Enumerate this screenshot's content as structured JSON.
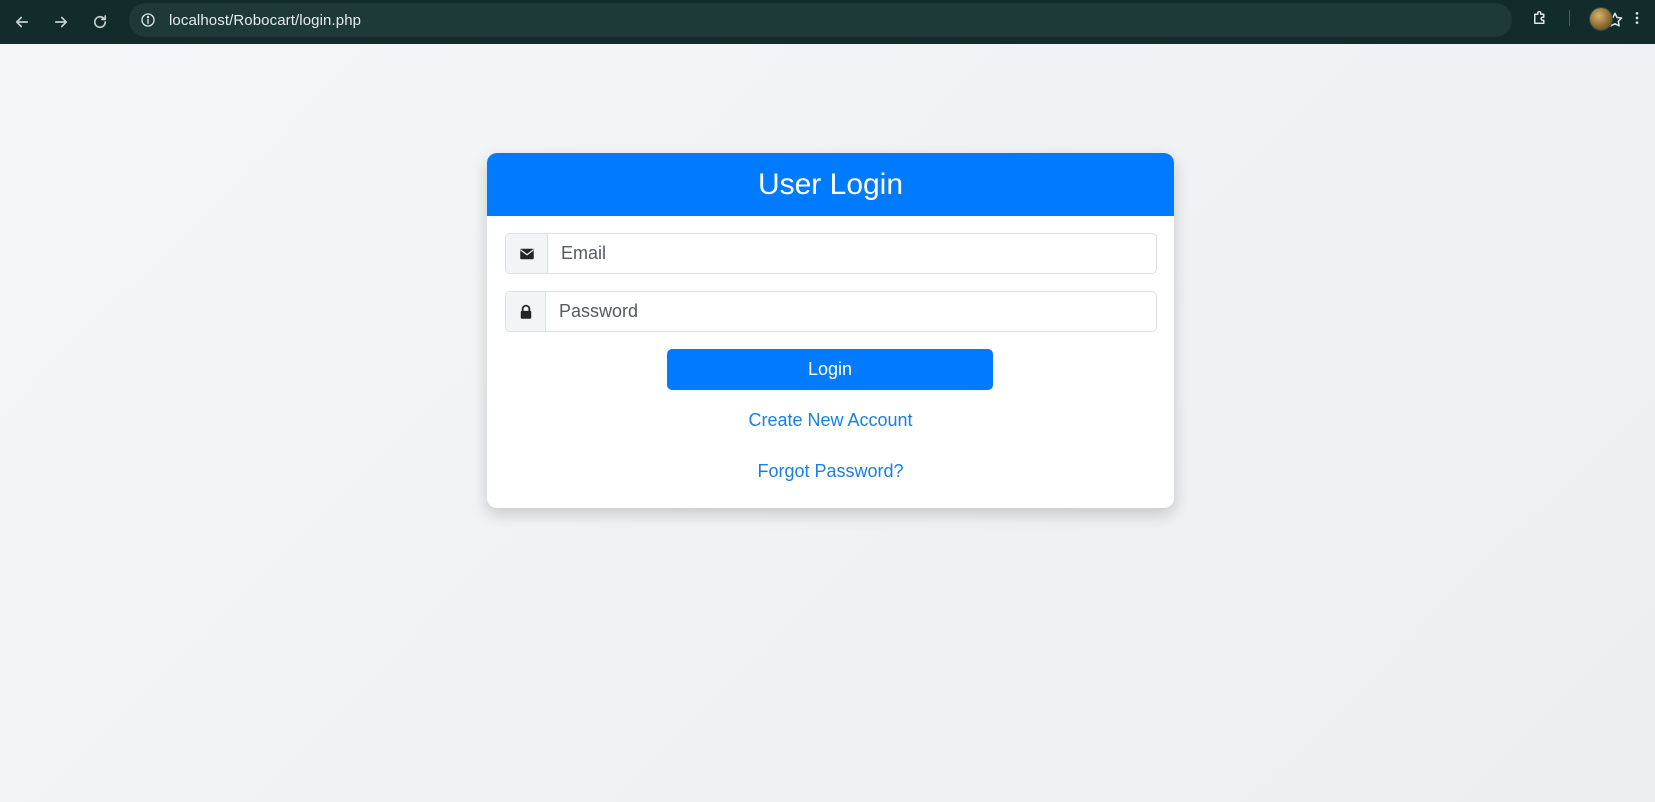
{
  "browser": {
    "url": "localhost/Robocart/login.php",
    "icons": {
      "back": "arrow-left-icon",
      "forward": "arrow-right-icon",
      "reload": "reload-icon",
      "site_info": "info-icon",
      "bookmark": "star-icon",
      "extensions": "puzzle-icon",
      "menu": "kebab-menu-icon"
    }
  },
  "login": {
    "title": "User Login",
    "email_placeholder": "Email",
    "password_placeholder": "Password",
    "login_label": "Login",
    "create_account_label": "Create New Account",
    "forgot_password_label": "Forgot Password?",
    "icons": {
      "email": "envelope-icon",
      "password": "lock-icon"
    }
  },
  "colors": {
    "primary": "#007bff",
    "link": "#1a7fe0",
    "browser_bar": "#122b2b"
  }
}
